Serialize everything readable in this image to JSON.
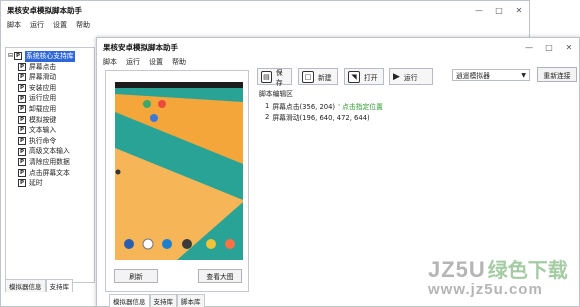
{
  "back_window": {
    "title": "果核安卓模拟脚本助手",
    "menu": [
      "脚本",
      "运行",
      "设置",
      "帮助"
    ],
    "tree": {
      "root": "系统核心支持库",
      "items": [
        "屏幕点击",
        "屏幕滑动",
        "安装应用",
        "运行应用",
        "卸载应用",
        "模拟按键",
        "文本输入",
        "执行命令",
        "高级文本输入",
        "清除应用数据",
        "点击屏幕文本",
        "延时"
      ]
    },
    "tabs": [
      "模拟器信息",
      "支持库"
    ]
  },
  "front_window": {
    "title": "果核安卓模拟脚本助手",
    "menu": [
      "脚本",
      "运行",
      "设置",
      "帮助"
    ],
    "toolbar": {
      "save": "保存",
      "new": "新建",
      "open": "打开",
      "run": "运行"
    },
    "emulator_select": "逍遥模拟器",
    "reconnect": "重新连接",
    "editor_title": "脚本编辑区",
    "script_lines": [
      {
        "num": "1",
        "cmd": "屏幕点击(356, 204)",
        "comment": "' 点击指定位置"
      },
      {
        "num": "2",
        "cmd": "屏幕滑动(196, 640, 472, 644)",
        "comment": ""
      }
    ],
    "refresh": "刷新",
    "view_large": "查看大图",
    "tabs": [
      "模拟器信息",
      "支持库",
      "脚本库"
    ]
  },
  "watermark": {
    "latin": "JZ5U",
    "cn": "绿色下载",
    "url": "www.jz5u.com"
  },
  "colors": {
    "selected": "#2f67d8",
    "comment": "#2e9a2e",
    "phone_bg": "#f4a63b",
    "phone_diag": "#2aa397"
  }
}
